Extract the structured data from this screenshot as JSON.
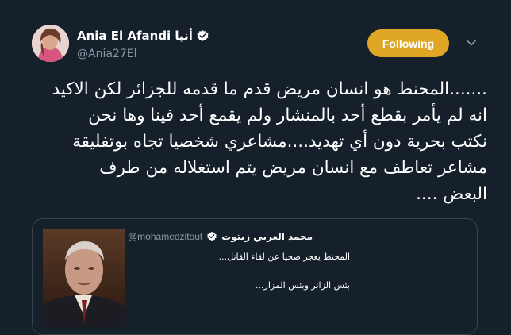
{
  "tweet": {
    "author": {
      "display_name": "Ania El Afandi أنيا",
      "handle": "@Ania27El",
      "avatar_icon": "profile-photo",
      "verified_icon": "verified-check-icon"
    },
    "follow_label": "Following",
    "menu_icon": "chevron-down-icon",
    "text_lines": [
      ".......المحنط هو انسان مريض قدم ما قدمه للجزائر لكن  الاكيد",
      "انه لم يأمر بقطع  أحد بالمنشار ولم يقمع أحد فينا وها نحن",
      "نكتب بحرية دون أي تهديد....مشاعري شخصيا تجاه بوتفليقة",
      "مشاعر تعاطف مع انسان مريض يتم استغلاله من طرف",
      "البعض ...."
    ],
    "quoted": {
      "display_name": "محمد العربي زيتوت",
      "handle": "@mohamedzitout",
      "lines": [
        "المحنط يعجز صحيا عن لقاء القاتل...",
        "بئس الزائر وبئس المزار..."
      ],
      "image_icon": "portrait-photo"
    }
  },
  "colors": {
    "background": "#15202b",
    "follow_button": "#e0a626",
    "secondary_text": "#8899a6",
    "border": "#38444d",
    "verified": "#ffffff"
  }
}
